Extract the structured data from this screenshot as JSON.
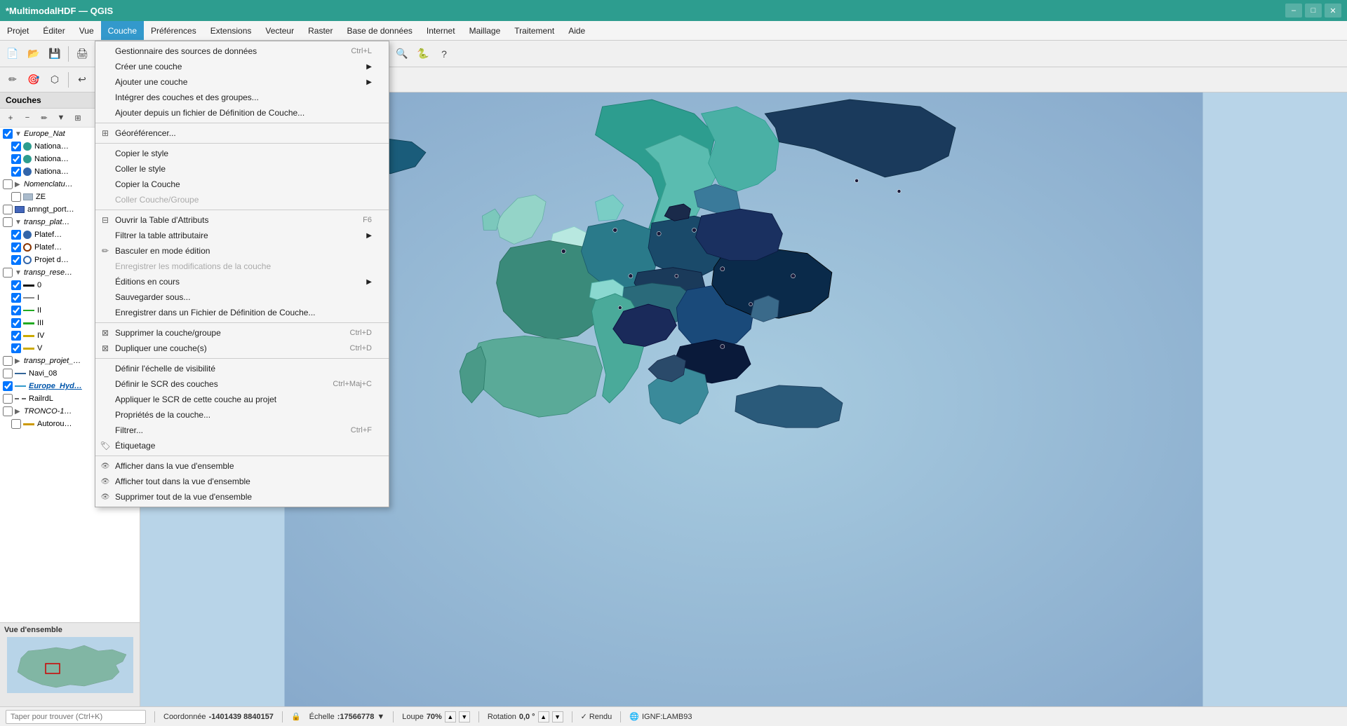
{
  "app": {
    "title": "*MultimodalHDF — QGIS",
    "win_min": "–",
    "win_max": "□",
    "win_close": "✕"
  },
  "menubar": {
    "items": [
      {
        "label": "Projet",
        "active": false
      },
      {
        "label": "Éditer",
        "active": false
      },
      {
        "label": "Vue",
        "active": false
      },
      {
        "label": "Couche",
        "active": true
      },
      {
        "label": "Préférences",
        "active": false
      },
      {
        "label": "Extensions",
        "active": false
      },
      {
        "label": "Vecteur",
        "active": false
      },
      {
        "label": "Raster",
        "active": false
      },
      {
        "label": "Base de données",
        "active": false
      },
      {
        "label": "Internet",
        "active": false
      },
      {
        "label": "Maillage",
        "active": false
      },
      {
        "label": "Traitement",
        "active": false
      },
      {
        "label": "Aide",
        "active": false
      }
    ]
  },
  "sidebar": {
    "header": "Couches",
    "layers": [
      {
        "id": "europe_nat",
        "label": "Europe_Nat",
        "indent": 0,
        "type": "group",
        "expanded": true,
        "checked": true,
        "bold": false
      },
      {
        "id": "national1",
        "label": "Nationa…",
        "indent": 1,
        "type": "dot-teal",
        "checked": true,
        "bold": false
      },
      {
        "id": "national2",
        "label": "Nationa…",
        "indent": 1,
        "type": "dot-teal",
        "checked": true,
        "bold": false
      },
      {
        "id": "national3",
        "label": "Nationa…",
        "indent": 1,
        "type": "dot-blue",
        "checked": true,
        "bold": false
      },
      {
        "id": "nomenclatu",
        "label": "Nomenclatu…",
        "indent": 0,
        "type": "group",
        "expanded": false,
        "checked": false,
        "bold": false
      },
      {
        "id": "ze",
        "label": "ZE",
        "indent": 1,
        "type": "poly",
        "checked": false,
        "bold": false
      },
      {
        "id": "amngt_port",
        "label": "amngt_port…",
        "indent": 0,
        "type": "rect-blue",
        "checked": false,
        "bold": false
      },
      {
        "id": "transp_plate",
        "label": "transp_plat…",
        "indent": 0,
        "type": "group",
        "expanded": true,
        "checked": false,
        "bold": false
      },
      {
        "id": "platef1",
        "label": "Platef…",
        "indent": 1,
        "type": "dot-blue",
        "checked": true,
        "bold": false
      },
      {
        "id": "platef2",
        "label": "Platef…",
        "indent": 1,
        "type": "circle-target",
        "checked": true,
        "bold": false
      },
      {
        "id": "projet",
        "label": "Projet d…",
        "indent": 1,
        "type": "hollow-circle",
        "checked": true,
        "bold": false
      },
      {
        "id": "transp_rese",
        "label": "transp_rese…",
        "indent": 0,
        "type": "group",
        "expanded": true,
        "checked": false,
        "bold": false
      },
      {
        "id": "line0",
        "label": "0",
        "indent": 1,
        "type": "line-black",
        "checked": true,
        "bold": false
      },
      {
        "id": "line1",
        "label": "I",
        "indent": 1,
        "type": "line-gray",
        "checked": true,
        "bold": false
      },
      {
        "id": "line2",
        "label": "II",
        "indent": 1,
        "type": "line-green",
        "checked": true,
        "bold": false
      },
      {
        "id": "line3",
        "label": "III",
        "indent": 1,
        "type": "line-green-thick",
        "checked": true,
        "bold": false
      },
      {
        "id": "line4",
        "label": "IV",
        "indent": 1,
        "type": "line-yellow",
        "checked": true,
        "bold": false
      },
      {
        "id": "line5",
        "label": "V",
        "indent": 1,
        "type": "line-yellow",
        "checked": true,
        "bold": false
      },
      {
        "id": "transp_projet",
        "label": "transp_projet_…",
        "indent": 0,
        "type": "group",
        "expanded": false,
        "checked": false,
        "bold": false
      },
      {
        "id": "navi08",
        "label": "Navi_08",
        "indent": 0,
        "type": "line-blue",
        "checked": false,
        "bold": false
      },
      {
        "id": "europe_hyd",
        "label": "Europe_Hyd…",
        "indent": 0,
        "type": "line-blue-bold",
        "checked": true,
        "bold": true,
        "italic": true,
        "underline": true
      },
      {
        "id": "railrdl",
        "label": "RailrdL",
        "indent": 0,
        "type": "line-dashed",
        "checked": false,
        "bold": false
      },
      {
        "id": "tronco1",
        "label": "TRONCO-1…",
        "indent": 0,
        "type": "group",
        "expanded": false,
        "checked": false,
        "bold": false
      },
      {
        "id": "autorou",
        "label": "Autorou…",
        "indent": 1,
        "type": "line-yellow2",
        "checked": false,
        "bold": false
      }
    ]
  },
  "dropdown": {
    "title": "Couche",
    "items": [
      {
        "id": "gestionnaire",
        "label": "Gestionnaire des sources de données",
        "shortcut": "Ctrl+L",
        "icon": "",
        "disabled": false,
        "sep_after": false
      },
      {
        "id": "creer",
        "label": "Créer une couche",
        "shortcut": "",
        "icon": "",
        "disabled": false,
        "sep_after": false,
        "has_arrow": true
      },
      {
        "id": "ajouter",
        "label": "Ajouter une couche",
        "shortcut": "",
        "icon": "",
        "disabled": false,
        "sep_after": false,
        "has_arrow": true
      },
      {
        "id": "integrer",
        "label": "Intégrer des couches et des groupes...",
        "shortcut": "",
        "icon": "",
        "disabled": false,
        "sep_after": false
      },
      {
        "id": "ajouter_def",
        "label": "Ajouter depuis un fichier de Définition de Couche...",
        "shortcut": "",
        "icon": "",
        "disabled": false,
        "sep_after": true
      },
      {
        "id": "georef",
        "label": "Géoréférencer...",
        "shortcut": "",
        "icon": "⊞",
        "disabled": false,
        "sep_after": true
      },
      {
        "id": "copier_style",
        "label": "Copier le style",
        "shortcut": "",
        "icon": "",
        "disabled": false,
        "sep_after": false
      },
      {
        "id": "coller_style",
        "label": "Coller le style",
        "shortcut": "",
        "icon": "",
        "disabled": false,
        "sep_after": false
      },
      {
        "id": "copier_couche",
        "label": "Copier la Couche",
        "shortcut": "",
        "icon": "",
        "disabled": false,
        "sep_after": false
      },
      {
        "id": "coller_couche",
        "label": "Coller Couche/Groupe",
        "shortcut": "",
        "icon": "",
        "disabled": true,
        "sep_after": true
      },
      {
        "id": "ouvrir_table",
        "label": "Ouvrir la Table d'Attributs",
        "shortcut": "F6",
        "icon": "⊟",
        "disabled": false,
        "sep_after": false
      },
      {
        "id": "filtrer_table",
        "label": "Filtrer la table attributaire",
        "shortcut": "",
        "icon": "",
        "disabled": false,
        "sep_after": false,
        "has_arrow": true
      },
      {
        "id": "basculer",
        "label": "Basculer en mode édition",
        "shortcut": "",
        "icon": "✏",
        "disabled": false,
        "sep_after": false
      },
      {
        "id": "enregistrer_modif",
        "label": "Enregistrer les modifications de la couche",
        "shortcut": "",
        "icon": "",
        "disabled": true,
        "sep_after": false
      },
      {
        "id": "editions",
        "label": "Éditions en cours",
        "shortcut": "",
        "icon": "",
        "disabled": false,
        "sep_after": false,
        "has_arrow": true
      },
      {
        "id": "sauvegarder",
        "label": "Sauvegarder sous...",
        "shortcut": "",
        "icon": "",
        "disabled": false,
        "sep_after": false
      },
      {
        "id": "enregistrer_def",
        "label": "Enregistrer dans un Fichier de Définition de Couche...",
        "shortcut": "",
        "icon": "",
        "disabled": false,
        "sep_after": true
      },
      {
        "id": "supprimer",
        "label": "Supprimer la couche/groupe",
        "shortcut": "Ctrl+D",
        "icon": "⊠",
        "disabled": false,
        "sep_after": false
      },
      {
        "id": "dupliquer",
        "label": "Dupliquer une couche(s)",
        "shortcut": "Ctrl+D",
        "icon": "⊠",
        "disabled": false,
        "sep_after": true
      },
      {
        "id": "echelle",
        "label": "Définir l'échelle de visibilité",
        "shortcut": "",
        "icon": "",
        "disabled": false,
        "sep_after": false
      },
      {
        "id": "scr_couches",
        "label": "Définir le SCR des couches",
        "shortcut": "Ctrl+Maj+C",
        "icon": "",
        "disabled": false,
        "sep_after": false
      },
      {
        "id": "appliquer_scr",
        "label": "Appliquer le SCR de cette couche au projet",
        "shortcut": "",
        "icon": "",
        "disabled": false,
        "sep_after": false
      },
      {
        "id": "proprietes",
        "label": "Propriétés de la couche...",
        "shortcut": "",
        "icon": "",
        "disabled": false,
        "sep_after": false
      },
      {
        "id": "filtrer",
        "label": "Filtrer...",
        "shortcut": "Ctrl+F",
        "icon": "",
        "disabled": false,
        "sep_after": false
      },
      {
        "id": "etiquetage",
        "label": "Étiquetage",
        "shortcut": "",
        "icon": "🏷",
        "disabled": false,
        "sep_after": true
      },
      {
        "id": "afficher_vue",
        "label": "Afficher dans la vue d'ensemble",
        "shortcut": "",
        "icon": "👁",
        "disabled": false,
        "sep_after": false
      },
      {
        "id": "afficher_tout",
        "label": "Afficher tout dans la vue d'ensemble",
        "shortcut": "",
        "icon": "👁",
        "disabled": false,
        "sep_after": false
      },
      {
        "id": "supprimer_vue",
        "label": "Supprimer tout de la vue d'ensemble",
        "shortcut": "",
        "icon": "👁",
        "disabled": false,
        "sep_after": false
      }
    ]
  },
  "statusbar": {
    "search_placeholder": "Taper pour trouver (Ctrl+K)",
    "coordonnee_label": "Coordonnée",
    "coordonnee_value": "-1401439  8840157",
    "echelle_label": "Échelle",
    "echelle_value": ":17566778",
    "loupe_label": "Loupe",
    "loupe_value": "70%",
    "rotation_label": "Rotation",
    "rotation_value": "0,0 °",
    "rendu_label": "✓ Rendu",
    "crs_label": "IGNF:LAMB93"
  },
  "overview": {
    "label": "Vue d'ensemble"
  }
}
